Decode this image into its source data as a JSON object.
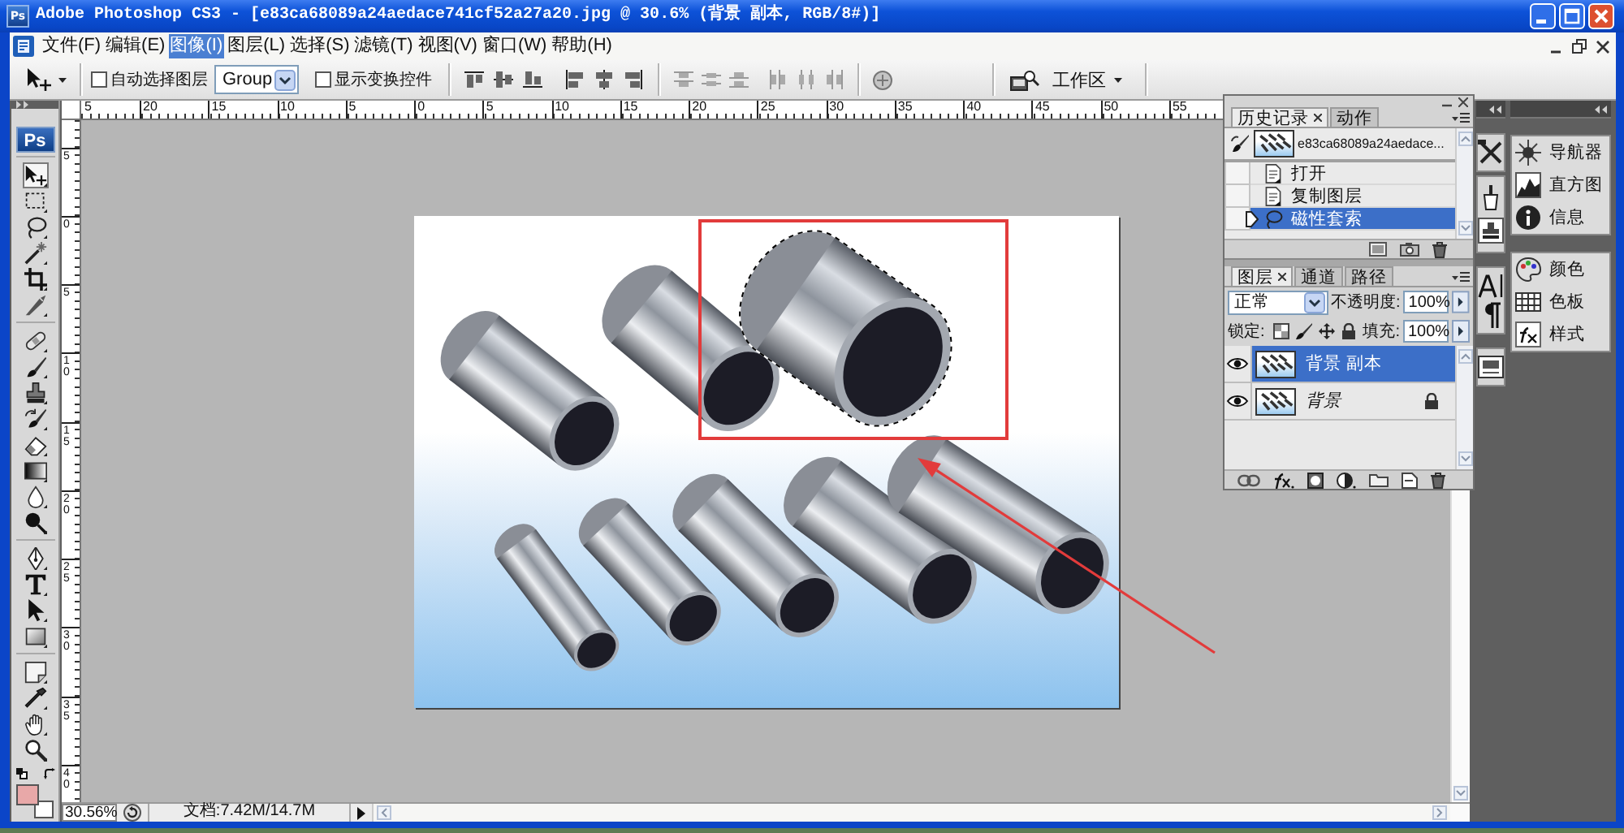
{
  "window": {
    "icon_text": "Ps",
    "title": "Adobe Photoshop CS3 - [e83ca68089a24aedace741cf52a27a20.jpg @ 30.6% (背景 副本, RGB/8#)]"
  },
  "menu_bar": {
    "items": [
      {
        "label": "文件(F)",
        "selected": false
      },
      {
        "label": "编辑(E)",
        "selected": false
      },
      {
        "label": "图像(I)",
        "selected": true
      },
      {
        "label": "图层(L)",
        "selected": false
      },
      {
        "label": "选择(S)",
        "selected": false
      },
      {
        "label": "滤镜(T)",
        "selected": false
      },
      {
        "label": "视图(V)",
        "selected": false
      },
      {
        "label": "窗口(W)",
        "selected": false
      },
      {
        "label": "帮助(H)",
        "selected": false
      }
    ]
  },
  "options_bar": {
    "auto_select": {
      "label": "自动选择图层",
      "checked": false
    },
    "auto_select_mode": {
      "value": "Group"
    },
    "show_transform": {
      "label": "显示变换控件",
      "checked": false
    },
    "workspace": {
      "label": "工作区"
    }
  },
  "toolbox": {
    "logo": "Ps",
    "tool_groups": [
      {
        "tools": [
          {
            "kind": "move",
            "selected": true
          },
          {
            "kind": "marquee",
            "selected": false
          },
          {
            "kind": "lasso",
            "selected": false
          },
          {
            "kind": "wand",
            "selected": false
          },
          {
            "kind": "crop",
            "selected": false
          },
          {
            "kind": "slice",
            "selected": false
          }
        ]
      },
      {
        "tools": [
          {
            "kind": "heal",
            "selected": false
          },
          {
            "kind": "brush",
            "selected": false
          },
          {
            "kind": "stamp",
            "selected": false
          },
          {
            "kind": "historybrush",
            "selected": false
          },
          {
            "kind": "eraser",
            "selected": false
          },
          {
            "kind": "gradient",
            "selected": false
          },
          {
            "kind": "blur",
            "selected": false
          },
          {
            "kind": "dodge",
            "selected": false
          }
        ]
      },
      {
        "tools": [
          {
            "kind": "pen",
            "selected": false
          },
          {
            "kind": "type",
            "selected": false
          },
          {
            "kind": "pathselect",
            "selected": false
          },
          {
            "kind": "shape",
            "selected": false
          }
        ]
      },
      {
        "tools": [
          {
            "kind": "notes",
            "selected": false
          },
          {
            "kind": "eyedropper",
            "selected": false
          },
          {
            "kind": "hand",
            "selected": false
          },
          {
            "kind": "zoom",
            "selected": false
          }
        ]
      }
    ],
    "swatches": [
      {
        "kind": "foreground",
        "color": "#e8a8a8"
      },
      {
        "kind": "background",
        "color": "#ffffff"
      }
    ]
  },
  "rulers": {
    "horizontal": [
      "5",
      "20",
      "15",
      "10",
      "5",
      "0",
      "5",
      "10",
      "15",
      "20",
      "25",
      "30",
      "35",
      "40",
      "45",
      "50",
      "55"
    ],
    "vertical": [
      "5",
      "0",
      "5",
      "10",
      "15",
      "20",
      "25",
      "30",
      "35",
      "40"
    ]
  },
  "history_panel": {
    "tabs": [
      {
        "label": "历史记录",
        "selected": true
      },
      {
        "label": "动作",
        "selected": false
      }
    ],
    "snapshot": {
      "label": "e83ca68089a24aedace...",
      "source": true
    },
    "steps": [
      {
        "label": "打开",
        "kind": "document",
        "source": false,
        "selected": false
      },
      {
        "label": "复制图层",
        "kind": "document",
        "source": false,
        "selected": false
      },
      {
        "label": "磁性套索",
        "kind": "lasso",
        "source": false,
        "selected": true
      }
    ]
  },
  "layers_panel": {
    "tabs": [
      {
        "label": "图层",
        "selected": true
      },
      {
        "label": "通道",
        "selected": false
      },
      {
        "label": "路径",
        "selected": false
      }
    ],
    "blend_mode": "正常",
    "opacity_label": "不透明度:",
    "opacity": "100%",
    "lock_label": "锁定:",
    "fill_label": "填充:",
    "fill": "100%",
    "layers": [
      {
        "name": "背景 副本",
        "kind": "normal",
        "visible": true,
        "locked": false,
        "selected": true
      },
      {
        "name": "背景",
        "kind": "background",
        "visible": true,
        "locked": true,
        "selected": false
      }
    ]
  },
  "dock": {
    "panel_groups": [
      {
        "items": [
          {
            "label": "导航器",
            "kind": "navigator"
          },
          {
            "label": "直方图",
            "kind": "histogram"
          },
          {
            "label": "信息",
            "kind": "info"
          }
        ]
      },
      {
        "items": [
          {
            "label": "颜色",
            "kind": "color"
          },
          {
            "label": "色板",
            "kind": "swatches"
          },
          {
            "label": "样式",
            "kind": "styles"
          }
        ]
      }
    ]
  },
  "status_bar": {
    "zoom": "30.56%",
    "doc_info": "文档:7.42M/14.7M"
  }
}
